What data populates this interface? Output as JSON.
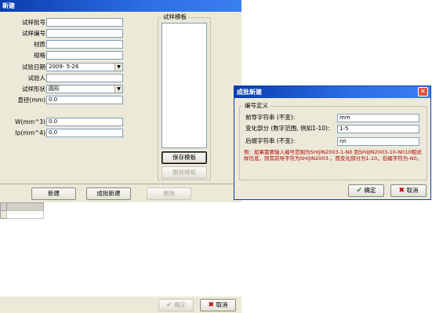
{
  "main_window": {
    "title": "新建",
    "labels": {
      "batch_no": "试样批号",
      "sample_no": "试样编号",
      "material": "材质",
      "spec": "规格",
      "test_date": "试验日期",
      "tester": "试验人",
      "shape": "试样形状",
      "diameter": "直径(mm)",
      "w": "W(mm^3)",
      "ip": "Ip(mm^4)"
    },
    "values": {
      "batch_no": "",
      "sample_no": "",
      "material": "",
      "spec": "",
      "test_date": "2009- 5-26",
      "tester": "",
      "shape": "圆形",
      "diameter": "0.0",
      "w": "0.0",
      "ip": "0.0"
    },
    "template_group_title": "试样模板",
    "save_template_button": "保存模板",
    "delete_template_button": "删除模板",
    "toolbar": {
      "new_button": "新建",
      "batch_new_button": "成批新建",
      "delete_button": "删除"
    },
    "ok_button": "确定",
    "cancel_button": "取消"
  },
  "dialog": {
    "title": "成批新建",
    "group_title": "编号定义",
    "labels": {
      "prefix": "前导字符串 (不变):",
      "variable": "变化部分 (数字范围, 例如1-10):",
      "suffix": "后缀字符串 (不变):"
    },
    "values": {
      "prefix": "mm",
      "variable": "1-5",
      "suffix": "nn"
    },
    "note": "例：如果需要输入编号范围为SHIJIN2003-1-N0 到SHIJIN2003-10-N010相试样信息，则其前导字符为SHIJIN2003-，而变化部分为1-10，后缀字符为-N0。",
    "ok_button": "确定",
    "cancel_button": "取消"
  },
  "colors": {
    "titlebar": "#0a3dad",
    "window_bg": "#ece9d8",
    "note_text": "#b00000",
    "ok_check": "#1f8f1f",
    "cancel_x": "#b00000"
  }
}
